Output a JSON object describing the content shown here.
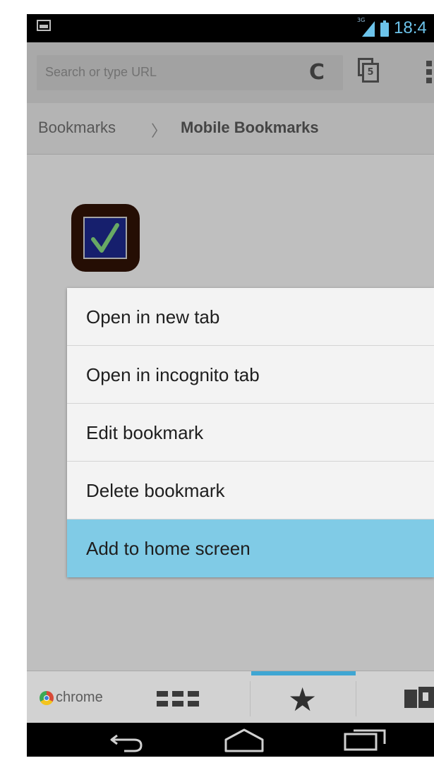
{
  "status_bar": {
    "network_label": "3G",
    "time": "18:4",
    "icons": [
      "image-icon",
      "signal-icon",
      "battery-icon"
    ],
    "accent_color": "#6cc3ea"
  },
  "toolbar": {
    "search_placeholder": "Search or type URL",
    "reload_icon": "reload-icon",
    "tab_count": "5",
    "menu_icon": "overflow-menu-icon"
  },
  "breadcrumb": {
    "root": "Bookmarks",
    "separator": "〉",
    "current": "Mobile Bookmarks"
  },
  "bookmark": {
    "icon": "checkbox-icon"
  },
  "context_menu": {
    "items": [
      {
        "label": "Open in new tab"
      },
      {
        "label": "Open in incognito tab"
      },
      {
        "label": "Edit bookmark"
      },
      {
        "label": "Delete bookmark"
      },
      {
        "label": "Add to home screen",
        "selected": true
      }
    ],
    "highlight_color": "#80cbe6"
  },
  "bottom_bar": {
    "brand_label": "chrome",
    "tabs": [
      {
        "icon": "most-visited-grid-icon"
      },
      {
        "icon": "bookmark-star-icon",
        "active": true
      },
      {
        "icon": "other-devices-icon"
      }
    ],
    "active_indicator_color": "#3fa6d3"
  },
  "nav_bar": {
    "buttons": [
      "back-icon",
      "home-icon",
      "recent-apps-icon"
    ]
  }
}
